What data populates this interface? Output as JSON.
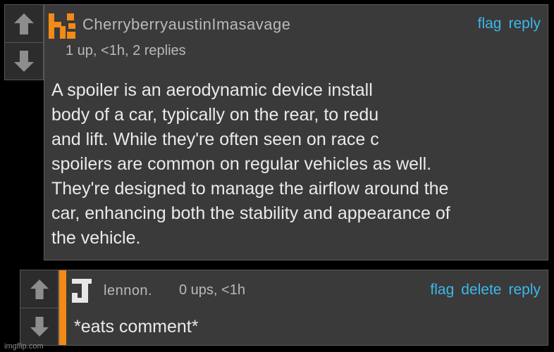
{
  "comment1": {
    "username": "CherryberryaustinImasavage",
    "meta": "1 up, <1h, 2 replies",
    "actions": [
      "flag",
      "reply"
    ],
    "body": "A spoiler is an aerodynamic device install body of a car, typically on the rear, to redu and lift. While they're often seen on race c spoilers are common on regular vehicles as well. They're designed to manage the airflow around the car, enhancing both the stability and appearance of the vehicle.",
    "body_lines": [
      "A spoiler is an aerodynamic device install",
      "body of a car, typically on the rear, to redu",
      "and lift. While they're often seen on race c",
      "spoilers are common on regular vehicles as well.",
      "They're designed to manage the airflow around the",
      "car, enhancing both the stability and appearance of",
      "the vehicle."
    ],
    "avatar_icon": "orange-pixel-avatar-icon",
    "avatar_color": "#f28a17"
  },
  "comment2": {
    "username": "lennon.",
    "meta": "0 ups, <1h",
    "actions": [
      "flag",
      "delete",
      "reply"
    ],
    "body": "*eats comment*",
    "avatar_icon": "letter-j-avatar-icon",
    "avatar_color": "#e6e6e6",
    "accent_color": "#f28a17"
  },
  "watermark": "imgflip.com",
  "colors": {
    "background": "#000000",
    "panel": "#3a3a3a",
    "link": "#3cb8ec",
    "meta_text": "#b9b9b9",
    "body_text": "#eaeaea"
  }
}
